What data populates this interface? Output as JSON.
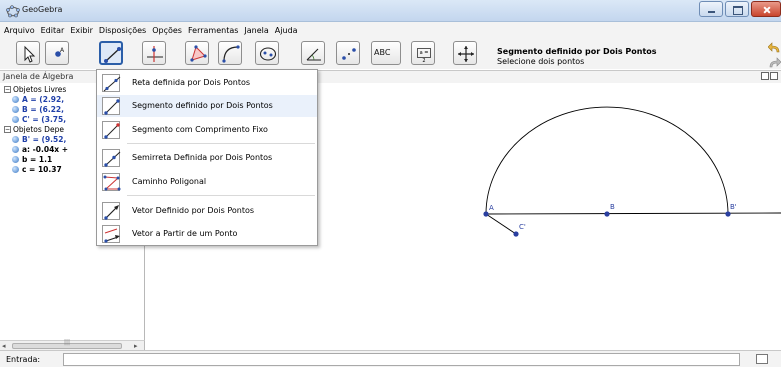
{
  "window": {
    "title": "GeoGebra",
    "icon": "geogebra-icon"
  },
  "menubar": {
    "items": [
      "Arquivo",
      "Editar",
      "Exibir",
      "Disposições",
      "Opções",
      "Ferramentas",
      "Janela",
      "Ajuda"
    ]
  },
  "toolbar": {
    "tools": [
      {
        "name": "move-tool-icon"
      },
      {
        "name": "point-tool-icon"
      },
      {
        "name": "segment-tool-icon",
        "selected": true
      },
      {
        "name": "perpendicular-line-tool-icon"
      },
      {
        "name": "polygon-tool-icon"
      },
      {
        "name": "circle-tool-icon"
      },
      {
        "name": "conic-tool-icon"
      },
      {
        "name": "angle-tool-icon"
      },
      {
        "name": "reflect-tool-icon"
      },
      {
        "name": "text-tool-icon",
        "label": "ABC"
      },
      {
        "name": "slider-tool-icon",
        "label": "a = 2"
      },
      {
        "name": "move-graphics-tool-icon"
      }
    ],
    "help_title": "Segmento definido por Dois Pontos",
    "help_text": "Selecione dois pontos"
  },
  "algebra": {
    "header": "Janela de Álgebra",
    "free_group": "Objetos Livres",
    "free_items": [
      "A = (2.92,",
      "B = (6.22,",
      "C' = (3.75,"
    ],
    "dependent_group": "Objetos Depe",
    "dependent_items": [
      "B' = (9.52,",
      "a: -0.04x +",
      "b = 1.1",
      "c = 10.37"
    ]
  },
  "dropdown": {
    "items": [
      {
        "label": "Reta definida por Dois Pontos",
        "icon": "line-icon"
      },
      {
        "label": "Segmento definido por Dois Pontos",
        "icon": "segment-icon",
        "highlighted": true
      },
      {
        "label": "Segmento com Comprimento Fixo",
        "icon": "fixed-segment-icon"
      },
      {
        "label": "Semirreta Definida por Dois Pontos",
        "icon": "ray-icon"
      },
      {
        "label": "Caminho Poligonal",
        "icon": "polyline-icon"
      },
      {
        "label": "Vetor Definido por Dois Pontos",
        "icon": "vector-icon"
      },
      {
        "label": "Vetor a Partir de um Ponto",
        "icon": "vector-from-point-icon"
      }
    ]
  },
  "graphics": {
    "points": [
      "A",
      "B",
      "B'",
      "C'"
    ]
  },
  "input": {
    "label": "Entrada:",
    "value": ""
  }
}
